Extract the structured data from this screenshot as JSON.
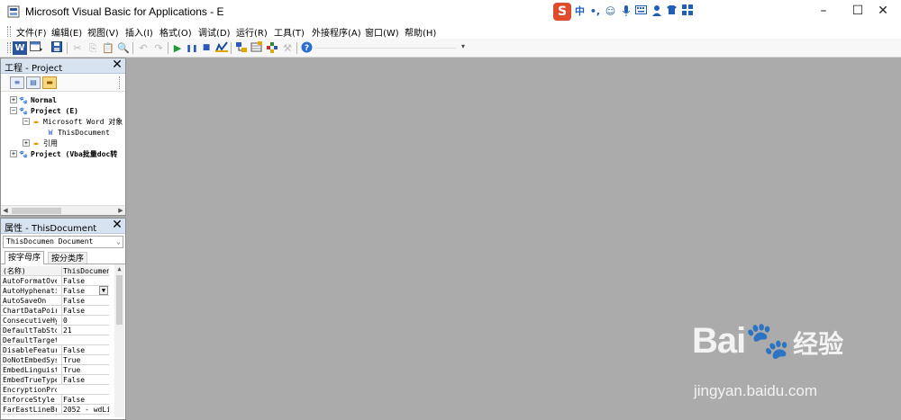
{
  "window": {
    "title": "Microsoft Visual Basic for Applications - E",
    "minimize": "–",
    "maximize": "☐",
    "close": "✕"
  },
  "ime": {
    "logo": "S",
    "items": [
      "中",
      "•,",
      "☺",
      "🎤",
      "⌨",
      "👕",
      "⊞"
    ]
  },
  "menu": {
    "items": [
      "文件(F)",
      "编辑(E)",
      "视图(V)",
      "插入(I)",
      "格式(O)",
      "调试(D)",
      "运行(R)",
      "工具(T)",
      "外接程序(A)",
      "窗口(W)",
      "帮助(H)"
    ]
  },
  "toolbar": {
    "word_icon": "W",
    "run": "▶",
    "pause": "❚❚",
    "stop": "■",
    "help": "?"
  },
  "project_pane": {
    "title": "工程 - Project",
    "close": "✕",
    "tree": [
      {
        "label": "Normal",
        "bold": true,
        "exp": "+"
      },
      {
        "label": "Project (E)",
        "bold": true,
        "exp": "−"
      },
      {
        "label": "Microsoft Word 对象",
        "bold": false,
        "exp": "−"
      },
      {
        "label": "ThisDocument",
        "bold": false,
        "exp": ""
      },
      {
        "label": "引用",
        "bold": false,
        "exp": "+"
      },
      {
        "label": "Project (Vba批量doc转",
        "bold": true,
        "exp": "+"
      }
    ]
  },
  "properties_pane": {
    "title": "属性 - ThisDocument",
    "close": "✕",
    "object_selector": "ThisDocumen Document",
    "tabs": [
      "按字母序",
      "按分类序"
    ],
    "rows": [
      {
        "name": "(名称)",
        "value": "ThisDocument"
      },
      {
        "name": "AutoFormatOve",
        "value": "False"
      },
      {
        "name": "AutoHyphenati",
        "value": "False"
      },
      {
        "name": "AutoSaveOn",
        "value": "False"
      },
      {
        "name": "ChartDataPoir",
        "value": "False"
      },
      {
        "name": "ConsecutiveHy",
        "value": "0"
      },
      {
        "name": "DefaultTabSto",
        "value": "21"
      },
      {
        "name": "DefaultTarget",
        "value": ""
      },
      {
        "name": "DisableFeatur",
        "value": "False"
      },
      {
        "name": "DoNotEmbedSys",
        "value": "True"
      },
      {
        "name": "EmbedLinguist",
        "value": "True"
      },
      {
        "name": "EmbedTrueType",
        "value": "False"
      },
      {
        "name": "EncryptionPro",
        "value": ""
      },
      {
        "name": "EnforceStyle",
        "value": "False"
      },
      {
        "name": "FarEastLineBr",
        "value": "2052 - wdLi"
      }
    ]
  },
  "watermark": {
    "logo": "Bai🐾",
    "cn": "经验",
    "url": "jingyan.baidu.com"
  },
  "colors": {
    "workspace": "#ababab",
    "pane_header": "#d8e3f2",
    "sogou": "#e04b2e"
  }
}
